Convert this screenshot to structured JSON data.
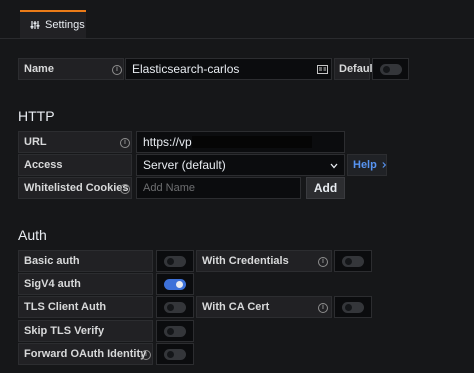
{
  "tab": {
    "label": "Settings",
    "icon": "sliders-icon",
    "accent": "#eb7b18"
  },
  "name_row": {
    "label": "Name",
    "value": "Elasticsearch-carlos",
    "default_label": "Default",
    "default_on": false
  },
  "http": {
    "title": "HTTP",
    "url_label": "URL",
    "url_value": "https://vpc-",
    "access_label": "Access",
    "access_value": "Server (default)",
    "help_label": "Help",
    "cookies_label": "Whitelisted Cookies",
    "cookies_placeholder": "Add Name",
    "add_label": "Add"
  },
  "auth": {
    "title": "Auth",
    "basic_auth": {
      "label": "Basic auth",
      "on": false
    },
    "with_credentials": {
      "label": "With Credentials",
      "on": false
    },
    "sigv4_auth": {
      "label": "SigV4 auth",
      "on": true
    },
    "tls_client_auth": {
      "label": "TLS Client Auth",
      "on": false
    },
    "with_ca_cert": {
      "label": "With CA Cert",
      "on": false
    },
    "skip_tls_verify": {
      "label": "Skip TLS Verify",
      "on": false
    },
    "forward_oauth": {
      "label": "Forward OAuth Identity",
      "on": false
    },
    "toggle_on_color": "#3d71d9"
  }
}
